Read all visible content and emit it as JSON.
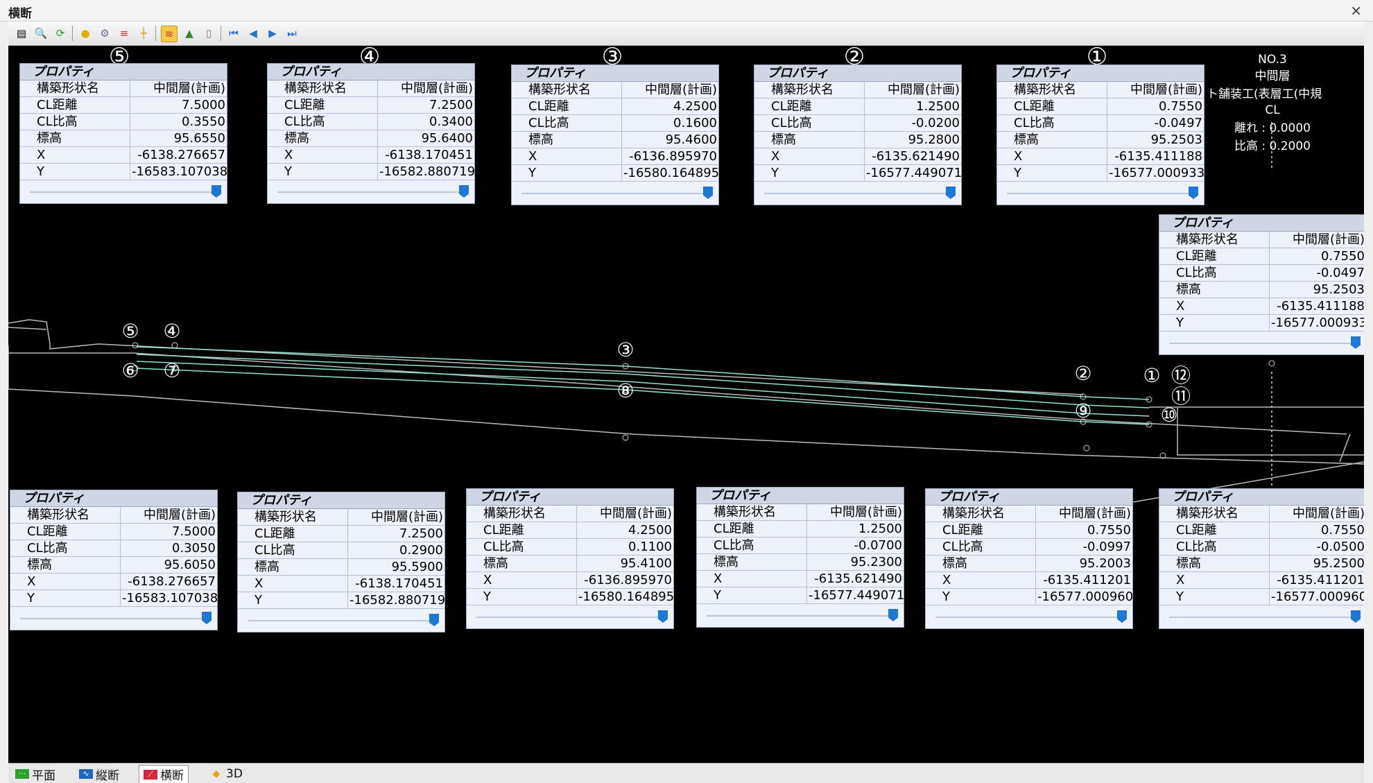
{
  "window": {
    "title": "横断",
    "close_glyph": "×"
  },
  "toolbar": {
    "icons": [
      "save-icon",
      "zoom-icon",
      "refresh-icon",
      "bulb-icon",
      "settings-icon",
      "measure-icon",
      "axis-icon",
      "layer-icon",
      "terrain-icon",
      "document-icon",
      "first-icon",
      "prev-icon",
      "next-icon",
      "last-icon"
    ]
  },
  "cl_annotation": {
    "no": "NO.3",
    "layer": "中間層",
    "line": "ト舗装工(表層工(中規",
    "cl": "CL",
    "offset": "離れ : 0.0000",
    "height": "比高 : 0.2000"
  },
  "panel_header": "プロパティ",
  "row_labels": [
    "構築形状名",
    "CL距離",
    "CL比高",
    "標高",
    "X",
    "Y"
  ],
  "panels": [
    {
      "id": "①",
      "values": [
        "中間層(計画)",
        "0.7550",
        "-0.0497",
        "95.2503",
        "-6135.411188",
        "-16577.000933"
      ]
    },
    {
      "id": "②",
      "values": [
        "中間層(計画)",
        "1.2500",
        "-0.0200",
        "95.2800",
        "-6135.621490",
        "-16577.449071"
      ]
    },
    {
      "id": "③",
      "values": [
        "中間層(計画)",
        "4.2500",
        "0.1600",
        "95.4600",
        "-6136.895970",
        "-16580.164895"
      ]
    },
    {
      "id": "④",
      "values": [
        "中間層(計画)",
        "7.2500",
        "0.3400",
        "95.6400",
        "-6138.170451",
        "-16582.880719"
      ]
    },
    {
      "id": "⑤",
      "values": [
        "中間層(計画)",
        "7.5000",
        "0.3550",
        "95.6550",
        "-6138.276657",
        "-16583.107038"
      ]
    },
    {
      "id": "⑥",
      "values": [
        "中間層(計画)",
        "7.5000",
        "0.3050",
        "95.6050",
        "-6138.276657",
        "-16583.107038"
      ]
    },
    {
      "id": "⑦",
      "values": [
        "中間層(計画)",
        "7.2500",
        "0.2900",
        "95.5900",
        "-6138.170451",
        "-16582.880719"
      ]
    },
    {
      "id": "⑧",
      "values": [
        "中間層(計画)",
        "4.2500",
        "0.1100",
        "95.4100",
        "-6136.895970",
        "-16580.164895"
      ]
    },
    {
      "id": "⑨",
      "values": [
        "中間層(計画)",
        "1.2500",
        "-0.0700",
        "95.2300",
        "-6135.621490",
        "-16577.449071"
      ]
    },
    {
      "id": "⑩",
      "values": [
        "中間層(計画)",
        "0.7550",
        "-0.0997",
        "95.2003",
        "-6135.411201",
        "-16577.000960"
      ]
    },
    {
      "id": "⑪",
      "values": [
        "中間層(計画)",
        "0.7550",
        "-0.0500",
        "95.2500",
        "-6135.411201",
        "-16577.000960"
      ]
    },
    {
      "id": "⑫",
      "values": [
        "中間層(計画)",
        "0.7550",
        "-0.0497",
        "95.2503",
        "-6135.411188",
        "-16577.000933"
      ]
    }
  ],
  "tabs": [
    {
      "label": "平面",
      "icon": "plan-icon"
    },
    {
      "label": "縦断",
      "icon": "profile-icon"
    },
    {
      "label": "横断",
      "icon": "cross-section-icon",
      "active": true
    },
    {
      "label": "3D",
      "icon": "3d-icon"
    }
  ]
}
